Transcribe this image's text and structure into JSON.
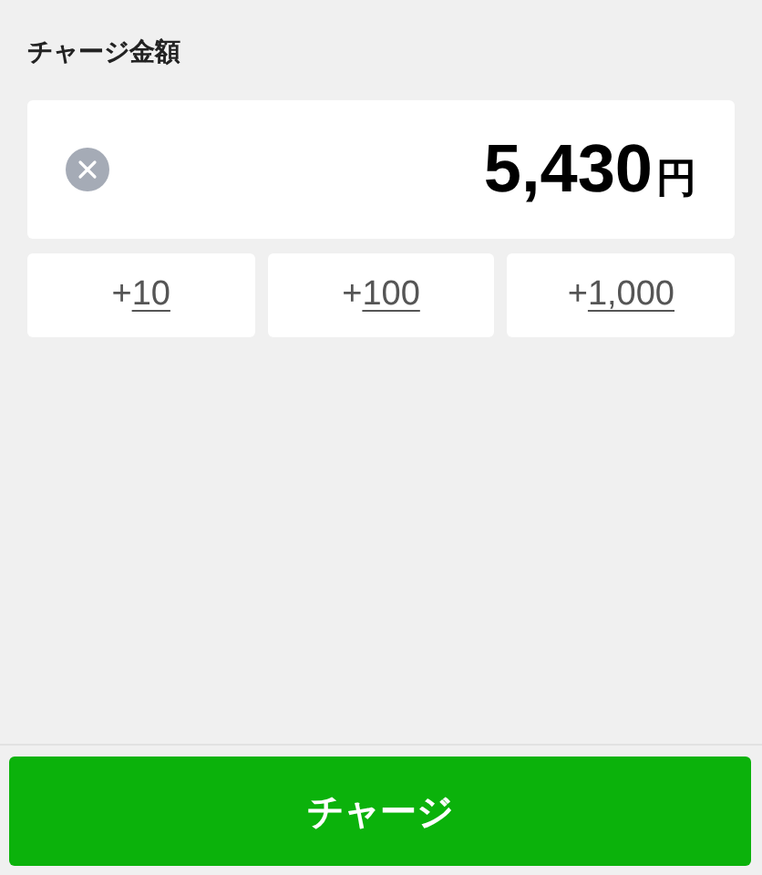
{
  "section_label": "チャージ金額",
  "amount": {
    "value": "5,430",
    "unit": "円"
  },
  "presets": [
    {
      "prefix": "+",
      "amount": "10"
    },
    {
      "prefix": "+",
      "amount": "100"
    },
    {
      "prefix": "+",
      "amount": "1,000"
    }
  ],
  "charge_button": "チャージ"
}
